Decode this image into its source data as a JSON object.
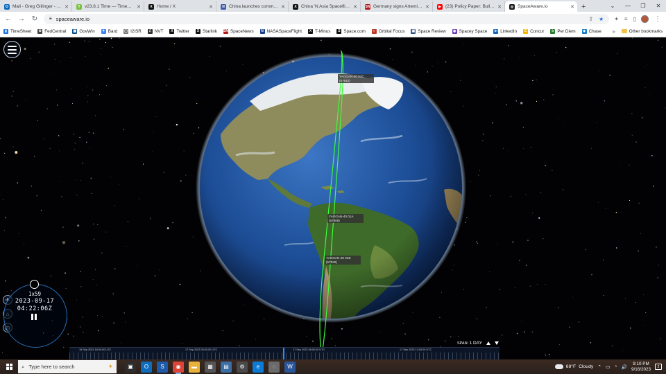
{
  "browser": {
    "tabs": [
      {
        "title": "Mail - Greg Gillinger - Outl",
        "icon_color": "#0f6cbd",
        "icon_glyph": "O"
      },
      {
        "title": "v23.8.1 Time — Timesheet",
        "icon_color": "#7cc242",
        "icon_glyph": "T"
      },
      {
        "title": "Home / X",
        "icon_color": "#111111",
        "icon_glyph": "X"
      },
      {
        "title": "China launches commercia",
        "icon_color": "#3b5ba9",
        "icon_glyph": "N"
      },
      {
        "title": "China 'N Asia Spaceflight",
        "icon_color": "#111111",
        "icon_glyph": "X"
      },
      {
        "title": "Germany signs Artemis Ac",
        "icon_color": "#b31b1b",
        "icon_glyph": "SN"
      },
      {
        "title": "(23) Policy Paper: Building",
        "icon_color": "#ff0000",
        "icon_glyph": "▶"
      },
      {
        "title": "SpaceAware.io",
        "icon_color": "#1a1a1a",
        "icon_glyph": "◎",
        "active": true
      }
    ],
    "new_tab": "+",
    "window_controls": [
      "⌄",
      "—",
      "❐",
      "✕"
    ],
    "url": "spaceaware.io",
    "nav": {
      "back": "←",
      "forward": "→",
      "reload": "↻"
    },
    "omnibox_icons": {
      "share": "⇪",
      "star": "★"
    },
    "toolbar_icons": [
      "✦",
      "≡",
      "▯",
      "⋮"
    ],
    "bookmarks": [
      {
        "label": "TimeSheet",
        "color": "#1a73e8",
        "glyph": "▮"
      },
      {
        "label": "FedCentral",
        "color": "#444444",
        "glyph": "⚙"
      },
      {
        "label": "GovWin",
        "color": "#0b4f8a",
        "glyph": "▦"
      },
      {
        "label": "Bard",
        "color": "#4285f4",
        "glyph": "✦"
      },
      {
        "label": "I2ISR",
        "color": "#777777",
        "glyph": "▢"
      },
      {
        "label": "NVT",
        "color": "#333333",
        "glyph": "ℰ"
      },
      {
        "label": "Twitter",
        "color": "#111111",
        "glyph": "X"
      },
      {
        "label": "Starlink",
        "color": "#111111",
        "glyph": "X"
      },
      {
        "label": "SpaceNews",
        "color": "#b31b1b",
        "glyph": "SN"
      },
      {
        "label": "NASASpaceFlight",
        "color": "#1c3f8c",
        "glyph": "N"
      },
      {
        "label": "T-Minus",
        "color": "#111111",
        "glyph": "X"
      },
      {
        "label": "Space.com",
        "color": "#111111",
        "glyph": "S"
      },
      {
        "label": "Orbital Focus",
        "color": "#c0392b",
        "glyph": "◐"
      },
      {
        "label": "Space Review",
        "color": "#2f4f7f",
        "glyph": "▣"
      },
      {
        "label": "Spacey Space",
        "color": "#6a3fb5",
        "glyph": "◉"
      },
      {
        "label": "LinkedIn",
        "color": "#0a66c2",
        "glyph": "in"
      },
      {
        "label": "Concur",
        "color": "#f2b400",
        "glyph": "C"
      },
      {
        "label": "Per Diem",
        "color": "#2e7d32",
        "glyph": "☆"
      },
      {
        "label": "Chase",
        "color": "#117aca",
        "glyph": "◆"
      }
    ],
    "bookmarks_more": "»",
    "other_bookmarks": "Other bookmarks"
  },
  "app": {
    "menu_icon": "hamburger-menu",
    "satellites": [
      {
        "name": "YAOGAN-40 01C",
        "id": "(57810)"
      },
      {
        "name": "YAOGAN-40 01A",
        "id": "(57808)"
      },
      {
        "name": "YAOGAN-40 01B",
        "id": "(57832)"
      }
    ],
    "orbit_color": "#3cff3c",
    "side_icons": [
      {
        "name": "satellite-icon",
        "glyph": "✈"
      },
      {
        "name": "home-icon",
        "glyph": "⌂"
      },
      {
        "name": "history-icon",
        "glyph": "◷"
      }
    ],
    "clock": {
      "rate": "1x59",
      "date": "2023-09-17",
      "time": "04:22:06Z"
    },
    "span": {
      "label": "SPAN:",
      "value": "1 DAY"
    },
    "timeline_labels": [
      "16 Sep 2023 18:00:00 UTC",
      "17 Sep 2023 00:00:00 UTC",
      "17 Sep 2023 06:00:00 UTC",
      "17 Sep 2023 12:00:00 UTC"
    ]
  },
  "taskbar": {
    "search_placeholder": "Type here to search",
    "apps": [
      {
        "name": "task-view-icon",
        "glyph": "▣",
        "color": "#2d2d2d"
      },
      {
        "name": "outlook-icon",
        "glyph": "O",
        "color": "#0f6cbd"
      },
      {
        "name": "spaceaware-app-icon",
        "glyph": "S",
        "color": "#1e5aa8"
      },
      {
        "name": "chrome-icon",
        "glyph": "◉",
        "color": "#db4437",
        "active": true
      },
      {
        "name": "file-explorer-icon",
        "glyph": "▬",
        "color": "#e8b13c"
      },
      {
        "name": "calculator-icon",
        "glyph": "▦",
        "color": "#555555"
      },
      {
        "name": "photos-icon",
        "glyph": "▤",
        "color": "#3a6ea5"
      },
      {
        "name": "settings-icon",
        "glyph": "⚙",
        "color": "#4a4a4a"
      },
      {
        "name": "edge-icon",
        "glyph": "e",
        "color": "#0b7bd6"
      },
      {
        "name": "chat-icon",
        "glyph": "◌",
        "color": "#6b6b6b"
      },
      {
        "name": "word-icon",
        "glyph": "W",
        "color": "#2b579a"
      }
    ],
    "weather": {
      "temp": "68°F",
      "condition": "Cloudy"
    },
    "tray_icons": [
      "⌃",
      "▭",
      "◔",
      "🔊"
    ],
    "time": "9:10 PM",
    "date": "9/16/2023",
    "notification_count": "2"
  }
}
